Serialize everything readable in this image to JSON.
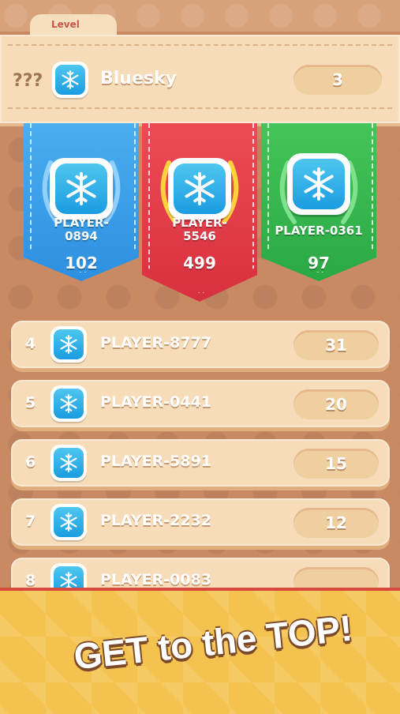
{
  "header": {
    "tab_label": "Level"
  },
  "me": {
    "rank": "???",
    "name": "Bluesky",
    "score": "3",
    "avatar_icon": "snowflake-icon"
  },
  "podium": [
    {
      "name_line1": "PLAYER-",
      "name_line2": "0894",
      "score": "102",
      "color": "#3a9ee8"
    },
    {
      "name_line1": "PLAYER-",
      "name_line2": "5546",
      "score": "499",
      "color": "#e23b46"
    },
    {
      "name_line1": "PLAYER-0361",
      "name_line2": "",
      "score": "97",
      "color": "#36b84e"
    }
  ],
  "rows": [
    {
      "rank": "4",
      "name": "PLAYER-8777",
      "score": "31"
    },
    {
      "rank": "5",
      "name": "PLAYER-0441",
      "score": "20"
    },
    {
      "rank": "6",
      "name": "PLAYER-5891",
      "score": "15"
    },
    {
      "rank": "7",
      "name": "PLAYER-2232",
      "score": "12"
    },
    {
      "rank": "8",
      "name": "PLAYER-0083",
      "score": ""
    }
  ],
  "footer": {
    "cta": "GET to the TOP!"
  }
}
